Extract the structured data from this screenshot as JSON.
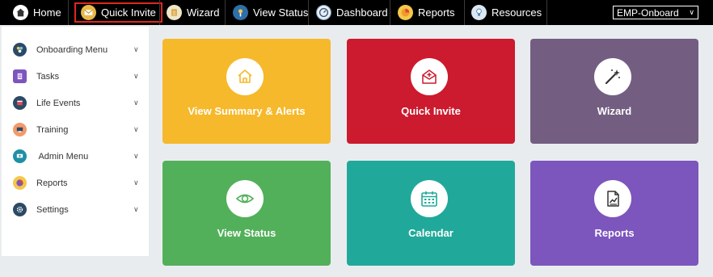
{
  "topbar": {
    "home_label": "Home",
    "items": [
      {
        "label": "Quick Invite",
        "icon": "envelope-icon"
      },
      {
        "label": "Wizard",
        "icon": "wizard-icon"
      },
      {
        "label": "View Status",
        "icon": "status-icon"
      },
      {
        "label": "Dashboard",
        "icon": "dashboard-icon"
      },
      {
        "label": "Reports",
        "icon": "reports-icon"
      },
      {
        "label": "Resources",
        "icon": "resources-icon"
      }
    ],
    "role_select_value": "EMP-Onboard"
  },
  "sidebar": {
    "items": [
      {
        "label": "Onboarding Menu",
        "icon": "onboarding-icon"
      },
      {
        "label": "Tasks",
        "icon": "tasks-icon"
      },
      {
        "label": "Life Events",
        "icon": "life-events-icon"
      },
      {
        "label": "Training",
        "icon": "training-icon"
      },
      {
        "label": " Admin Menu",
        "icon": "admin-icon"
      },
      {
        "label": "Reports",
        "icon": "reports-icon"
      },
      {
        "label": "Settings",
        "icon": "settings-icon"
      }
    ]
  },
  "tiles": [
    {
      "label": "View Summary & Alerts",
      "icon": "home-icon",
      "color": "#f6b92b"
    },
    {
      "label": "Quick Invite",
      "icon": "envelope-plus-icon",
      "color": "#cc1a2e"
    },
    {
      "label": "Wizard",
      "icon": "magic-wand-icon",
      "color": "#735e82"
    },
    {
      "label": "View Status",
      "icon": "eye-icon",
      "color": "#52b05a"
    },
    {
      "label": "Calendar",
      "icon": "calendar-icon",
      "color": "#20a99a"
    },
    {
      "label": "Reports",
      "icon": "chart-report-icon",
      "color": "#7c55bd"
    }
  ],
  "colors": {
    "topbar_bg": "#000000",
    "home_accent": "#4fb3ff",
    "highlight_border": "#e0261e",
    "page_bg": "#e9ecef"
  }
}
